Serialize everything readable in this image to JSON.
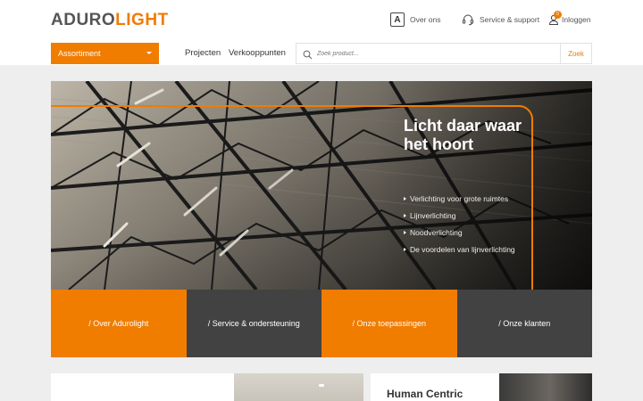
{
  "header": {
    "logo_part1": "ADURO",
    "logo_part2": "LIGHT",
    "about_label": "Over ons",
    "about_icon": "A",
    "service_label": "Service & support",
    "login_label": "Inloggen",
    "cart_badge": "0"
  },
  "nav": {
    "assortment_label": "Assortiment",
    "links": [
      "Projecten",
      "Verkooppunten"
    ],
    "search_placeholder": "Zoek product...",
    "search_button": "Zoek"
  },
  "hero": {
    "title": "Licht daar waar het hoort",
    "items": [
      "Verlichting voor grote ruimtes",
      "Lijnverlichting",
      "Noodverlichting",
      "De voordelen van lijnverlichting"
    ]
  },
  "tiles": [
    {
      "label": "/ Over Adurolight",
      "color": "#f07c00"
    },
    {
      "label": "/ Service & ondersteuning",
      "color": "#424242"
    },
    {
      "label": "/ Onze toepassingen",
      "color": "#f07c00"
    },
    {
      "label": "/ Onze klanten",
      "color": "#424242"
    }
  ],
  "cards": {
    "card2_title": "Human Centric"
  },
  "colors": {
    "accent": "#f07c00",
    "dark": "#424242"
  }
}
